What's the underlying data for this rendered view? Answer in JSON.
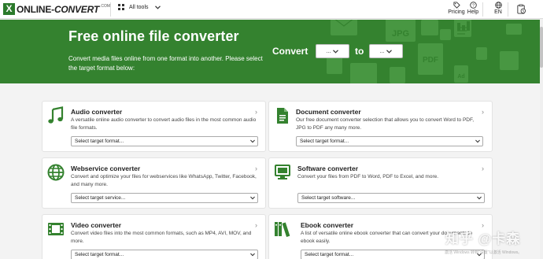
{
  "colors": {
    "brand_green": "#34822f",
    "card_bg": "#ffffff",
    "page_bg": "#f3f3f3"
  },
  "header": {
    "logo_mark": "X",
    "logo_text_1": "ONLINE-",
    "logo_text_2": "CONVERT",
    "logo_com": ".COM",
    "all_tools": "All tools",
    "pricing": "Pricing",
    "help": "Help",
    "language": "EN"
  },
  "hero": {
    "title": "Free online file converter",
    "subtitle": "Convert media files online from one format into another. Please select the target format below:",
    "convert_label": "Convert",
    "to_label": "to",
    "from_select": "...",
    "to_select": "...",
    "deco_labels": [
      "JPG",
      "PDF",
      "Ad"
    ]
  },
  "cards": [
    {
      "title": "Audio converter",
      "icon": "music-note-icon",
      "description": "A versatile online audio converter to convert audio files in the most common audio file formats.",
      "select": "Select target format..."
    },
    {
      "title": "Document converter",
      "icon": "document-icon",
      "description": "Our free document converter selection that allows you to convert Word to PDF, JPG to PDF any many more.",
      "select": "Select target format..."
    },
    {
      "title": "Webservice converter",
      "icon": "globe-icon",
      "description": "Convert and optimize your files for webservices like WhatsApp, Twitter, Facebook, and many more.",
      "select": "Select target service..."
    },
    {
      "title": "Software converter",
      "icon": "monitor-icon",
      "description": "Convert your files from PDF to Word, PDF to Excel, and more.",
      "select": "Select target software..."
    },
    {
      "title": "Video converter",
      "icon": "film-icon",
      "description": "Convert video files into the most common formats, such as MP4, AVI, MOV, and more.",
      "select": "Select target format..."
    },
    {
      "title": "Ebook converter",
      "icon": "books-icon",
      "description": "A list of versatile online ebook converter that can convert your documents to ebook easily.",
      "select": "Select target format..."
    }
  ],
  "watermark": {
    "text": "知乎 @卡森",
    "small": "激活 Windows 转到\"设置\"以激活 Windows。"
  }
}
